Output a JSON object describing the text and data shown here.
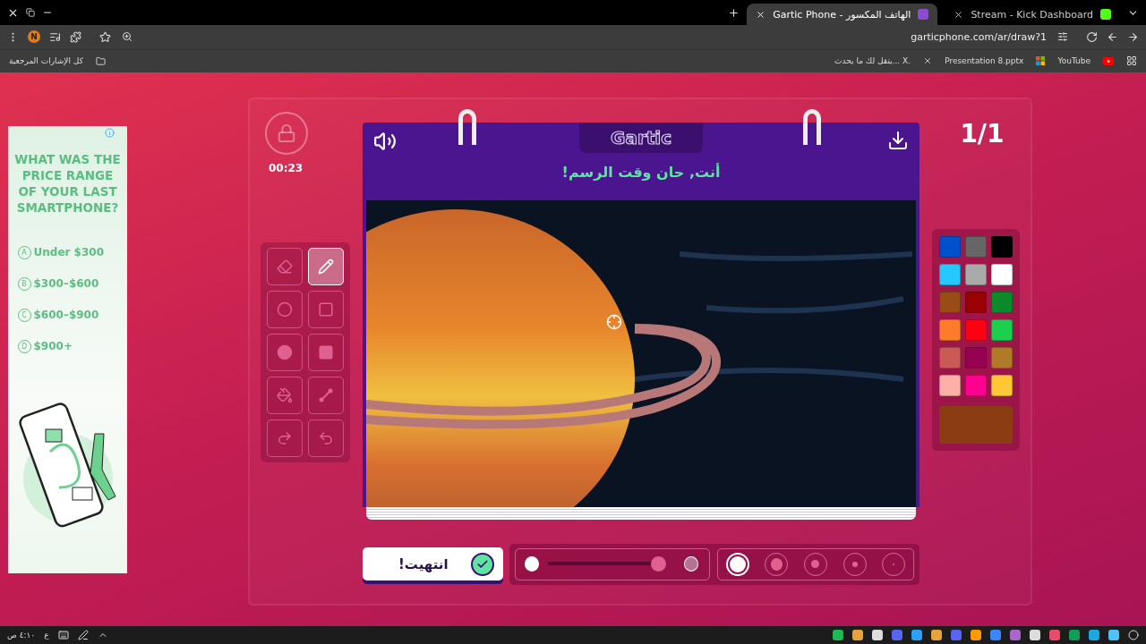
{
  "browser": {
    "tabs": [
      {
        "title": "Gartic Phone - الهاتف المكسور",
        "selected": true
      },
      {
        "title": "Stream - Kick Dashboard",
        "selected": false
      }
    ],
    "profile_initial": "N",
    "url": "garticphone.com/ar/draw?1",
    "bookmarks_folder": "كل الإشارات المرجعية",
    "bookmarks": [
      {
        "title": "يتقل لك ما يحدث... X.",
        "kind": "x"
      },
      {
        "title": "Presentation 8.pptx",
        "kind": "office"
      },
      {
        "title": "YouTube",
        "kind": "youtube"
      }
    ]
  },
  "ad": {
    "question": "WHAT WAS THE PRICE RANGE OF YOUR LAST SMARTPHONE?",
    "options": [
      {
        "letter": "A",
        "text": "Under $300"
      },
      {
        "letter": "B",
        "text": "$300–$600"
      },
      {
        "letter": "C",
        "text": "$600–$900"
      },
      {
        "letter": "D",
        "text": "$900+"
      }
    ]
  },
  "game": {
    "timer": "00:23",
    "logo": "Gartic",
    "prompt": "أنت, حان وقت الرسم!",
    "round": "1/1",
    "tools": [
      {
        "kind": "eraser",
        "selected": false
      },
      {
        "kind": "pencil",
        "selected": true
      },
      {
        "kind": "ellipse",
        "selected": false
      },
      {
        "kind": "rectangle",
        "selected": false
      },
      {
        "kind": "filled-ellipse",
        "selected": false
      },
      {
        "kind": "filled-rectangle",
        "selected": false
      },
      {
        "kind": "bucket",
        "selected": false
      },
      {
        "kind": "line",
        "selected": false
      },
      {
        "kind": "redo",
        "selected": false
      },
      {
        "kind": "undo",
        "selected": false
      }
    ],
    "colors": [
      {
        "color": "#0050cd"
      },
      {
        "color": "#666666"
      },
      {
        "color": "#000000"
      },
      {
        "color": "#26c9ff"
      },
      {
        "color": "#aaaaaa"
      },
      {
        "color": "#ffffff"
      },
      {
        "color": "#994c16"
      },
      {
        "color": "#990000"
      },
      {
        "color": "#0b8a2a"
      },
      {
        "color": "#ff7b2c"
      },
      {
        "color": "#ff0013"
      },
      {
        "color": "#1ccf4c"
      },
      {
        "color": "#cb5a57"
      },
      {
        "color": "#980051"
      },
      {
        "color": "#b17a28"
      },
      {
        "color": "#feafa8"
      },
      {
        "color": "#ff008f"
      },
      {
        "color": "#fec736"
      }
    ],
    "current_color": {
      "color": "#8b3c12"
    },
    "done_button": "انتهيت!",
    "opacity": {
      "level": 1
    },
    "sizes": [
      {
        "selected": true
      },
      {
        "selected": false
      },
      {
        "selected": false
      },
      {
        "selected": false
      },
      {
        "selected": false
      }
    ]
  },
  "taskbar": {
    "time": "٤:١٠ ص",
    "language": "ع"
  }
}
